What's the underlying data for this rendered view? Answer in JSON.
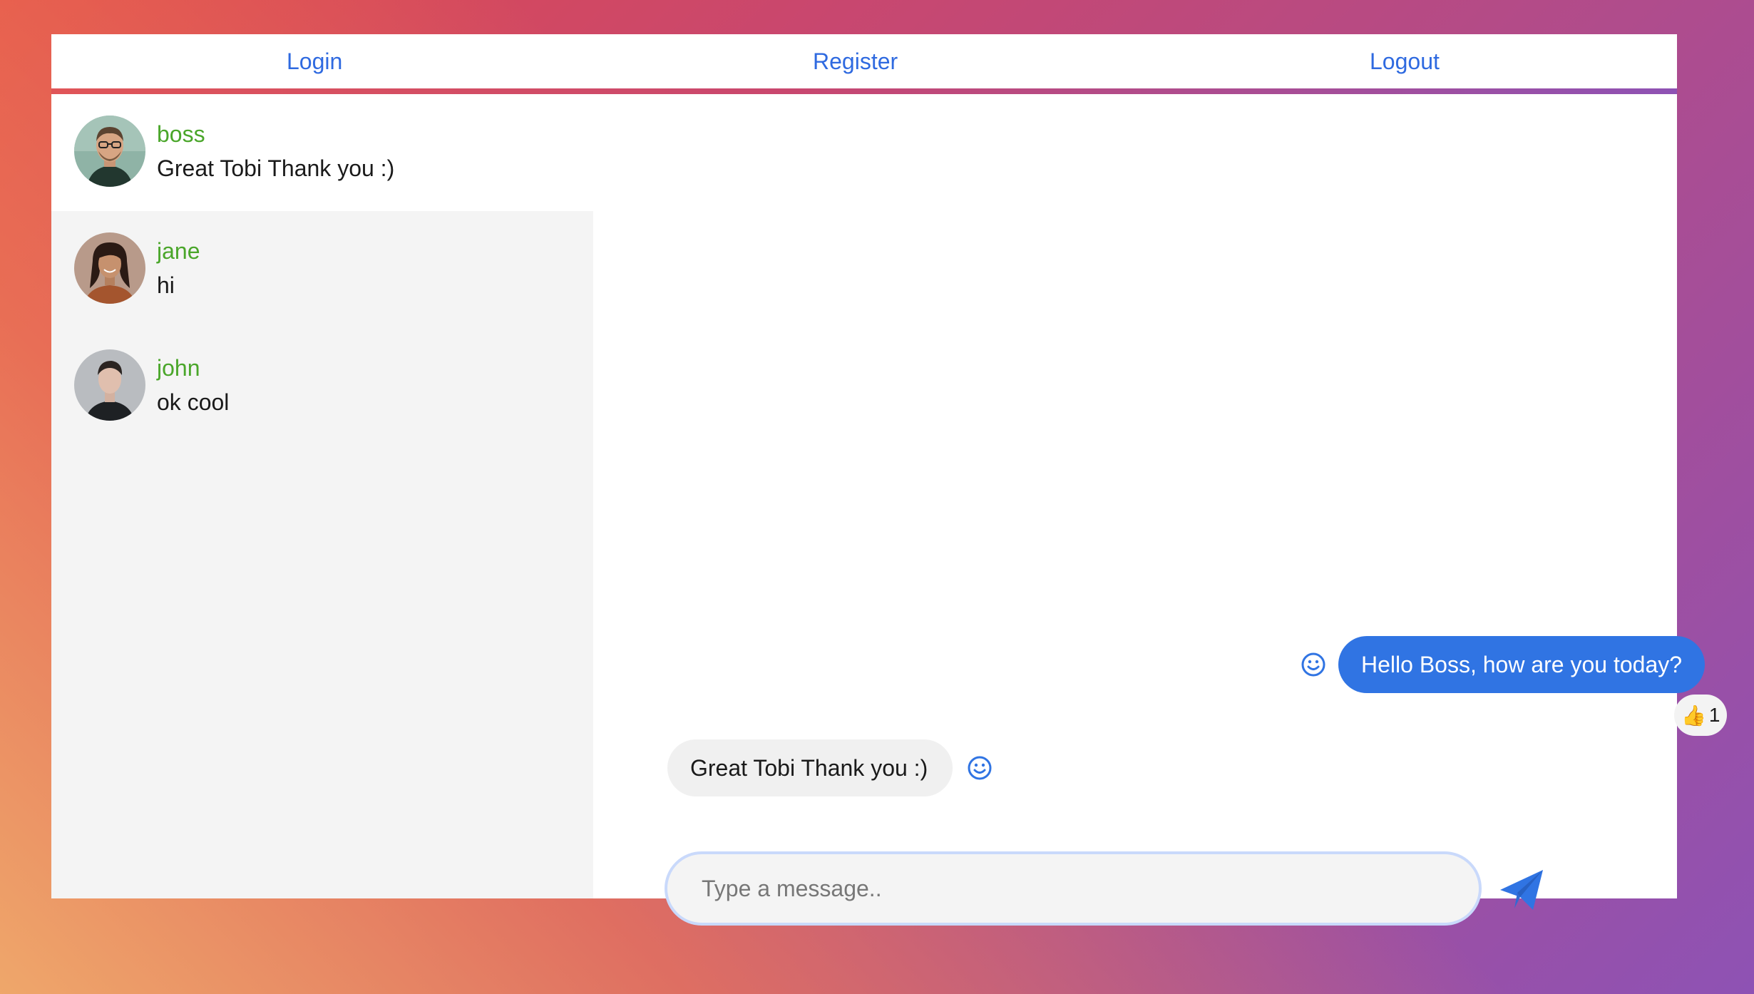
{
  "nav": {
    "login": "Login",
    "register": "Register",
    "logout": "Logout"
  },
  "conversations": [
    {
      "name": "boss",
      "last_message": "Great Tobi Thank you :)"
    },
    {
      "name": "jane",
      "last_message": "hi"
    },
    {
      "name": "john",
      "last_message": "ok cool"
    }
  ],
  "messages": [
    {
      "direction": "outgoing",
      "text": "Hello Boss, how are you today?",
      "reaction": {
        "emoji": "👍",
        "count": "1"
      }
    },
    {
      "direction": "incoming",
      "text": "Great Tobi Thank you :)"
    }
  ],
  "composer": {
    "placeholder": "Type a message..",
    "value": ""
  },
  "colors": {
    "accent": "#3074e3",
    "username": "#4aa62a",
    "link": "#2f6ae0",
    "sidebar_bg": "#f4f4f4",
    "incoming_bubble": "#f0f0f0"
  },
  "icons": {
    "emoji": "smiley-icon",
    "send": "paper-plane-icon"
  }
}
